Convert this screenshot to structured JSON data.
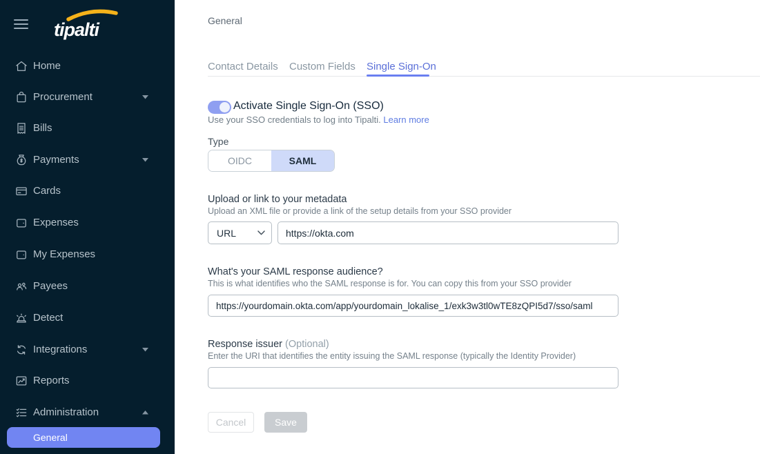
{
  "sidebar": {
    "logo": "tipalti",
    "items": [
      {
        "label": "Home",
        "icon": "home-icon",
        "expandable": false
      },
      {
        "label": "Procurement",
        "icon": "procurement-icon",
        "expandable": true,
        "expanded": false
      },
      {
        "label": "Bills",
        "icon": "bills-icon",
        "expandable": false
      },
      {
        "label": "Payments",
        "icon": "payments-icon",
        "expandable": true,
        "expanded": false
      },
      {
        "label": "Cards",
        "icon": "cards-icon",
        "expandable": false
      },
      {
        "label": "Expenses",
        "icon": "expenses-icon",
        "expandable": false
      },
      {
        "label": "My Expenses",
        "icon": "my-expenses-icon",
        "expandable": false
      },
      {
        "label": "Payees",
        "icon": "payees-icon",
        "expandable": false
      },
      {
        "label": "Detect",
        "icon": "detect-icon",
        "expandable": false
      },
      {
        "label": "Integrations",
        "icon": "integrations-icon",
        "expandable": true,
        "expanded": false
      },
      {
        "label": "Reports",
        "icon": "reports-icon",
        "expandable": false
      },
      {
        "label": "Administration",
        "icon": "administration-icon",
        "expandable": true,
        "expanded": true
      }
    ],
    "active_subitem": {
      "label": "General",
      "parent": "Administration"
    }
  },
  "page": {
    "title": "General"
  },
  "tabs": {
    "items": [
      {
        "label": "Contact Details",
        "active": false
      },
      {
        "label": "Custom Fields",
        "active": false
      },
      {
        "label": "Single Sign-On",
        "active": true
      }
    ]
  },
  "sso": {
    "toggle": {
      "label": "Activate Single Sign-On (SSO)",
      "state": "on"
    },
    "description": "Use your SSO credentials to log into Tipalti.",
    "learn_more": "Learn more",
    "type": {
      "label": "Type",
      "options": [
        "OIDC",
        "SAML"
      ],
      "selected": "SAML"
    },
    "metadata": {
      "heading": "Upload or link to your metadata",
      "description": "Upload an XML file or provide a link of the setup details from your SSO provider",
      "source_select": {
        "value": "URL"
      },
      "url_input": {
        "value": "https://okta.com"
      }
    },
    "audience": {
      "heading": "What's your SAML response audience?",
      "description": "This is what identifies who the SAML response is for. You can copy this from your SSO provider",
      "input": {
        "value": "https://yourdomain.okta.com/app/yourdomain_lokalise_1/exk3w3tl0wTE8zQPI5d7/sso/saml"
      }
    },
    "issuer": {
      "heading": "Response issuer",
      "optional": "(Optional)",
      "description": "Enter the URI that identifies the entity issuing the SAML response (typically the Identity Provider)",
      "input": {
        "value": ""
      }
    },
    "actions": {
      "cancel": "Cancel",
      "save": "Save"
    }
  },
  "colors": {
    "sidebar_bg": "#051e2d",
    "accent": "#7185f2",
    "active_tab": "#5a6fd8",
    "link": "#5e7ce2",
    "selected_segment_bg": "#cfdaf9",
    "toggle_on": "#8f9ff1",
    "logo_swoosh": "#f5b21a",
    "disabled_save_bg": "#c9cdd1"
  }
}
